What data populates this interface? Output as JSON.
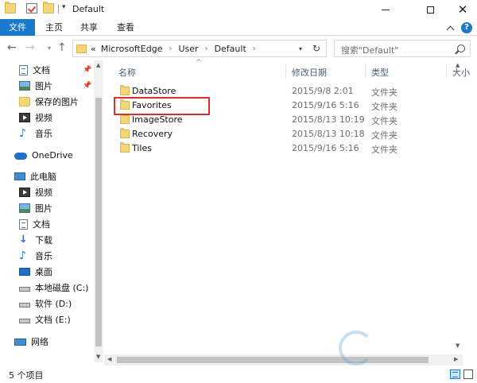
{
  "window": {
    "title": "Default"
  },
  "ribbon": {
    "tabs": [
      "文件",
      "主页",
      "共享",
      "查看"
    ]
  },
  "address": {
    "overflow": "«",
    "crumbs": [
      "MicrosoftEdge",
      "User",
      "Default"
    ],
    "separator": "›"
  },
  "search": {
    "placeholder": "搜索\"Default\""
  },
  "navpane": {
    "quick_access": [
      {
        "label": "文档",
        "icon": "documents-icon",
        "pinned": true
      },
      {
        "label": "图片",
        "icon": "pictures-icon",
        "pinned": true
      },
      {
        "label": "保存的图片",
        "icon": "folder-icon",
        "pinned": false
      },
      {
        "label": "视频",
        "icon": "videos-icon",
        "pinned": false
      },
      {
        "label": "音乐",
        "icon": "music-icon",
        "pinned": false
      }
    ],
    "onedrive": {
      "label": "OneDrive",
      "icon": "onedrive-icon"
    },
    "this_pc": {
      "label": "此电脑",
      "icon": "this-pc-icon"
    },
    "pc_items": [
      {
        "label": "视频",
        "icon": "videos-icon"
      },
      {
        "label": "图片",
        "icon": "pictures-icon"
      },
      {
        "label": "文档",
        "icon": "documents-icon"
      },
      {
        "label": "下载",
        "icon": "downloads-icon"
      },
      {
        "label": "音乐",
        "icon": "music-icon"
      },
      {
        "label": "桌面",
        "icon": "desktop-icon"
      },
      {
        "label": "本地磁盘 (C:)",
        "icon": "drive-icon"
      },
      {
        "label": "软件 (D:)",
        "icon": "drive-icon"
      },
      {
        "label": "文档 (E:)",
        "icon": "drive-icon"
      }
    ],
    "network": {
      "label": "网络",
      "icon": "network-icon"
    }
  },
  "columns": {
    "name": "名称",
    "date": "修改日期",
    "type": "类型",
    "size": "大小"
  },
  "files": [
    {
      "name": "DataStore",
      "date": "2015/9/8 2:01",
      "type": "文件夹"
    },
    {
      "name": "Favorites",
      "date": "2015/9/16 5:16",
      "type": "文件夹",
      "highlighted": true
    },
    {
      "name": "ImageStore",
      "date": "2015/8/13 10:19",
      "type": "文件夹"
    },
    {
      "name": "Recovery",
      "date": "2015/8/13 10:18",
      "type": "文件夹"
    },
    {
      "name": "Tiles",
      "date": "2015/9/16 5:16",
      "type": "文件夹"
    }
  ],
  "status": {
    "item_count": "5 个项目"
  },
  "colors": {
    "accent": "#1979ca",
    "highlight_box": "#d9302e",
    "folder": "#f4d67a"
  }
}
